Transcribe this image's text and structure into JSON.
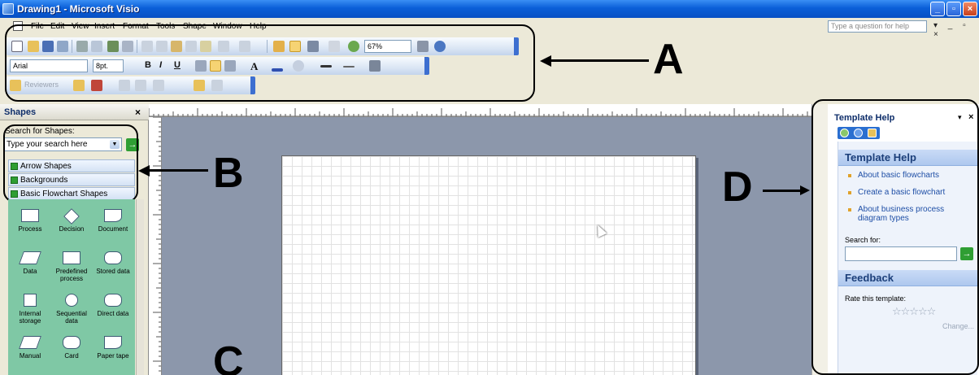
{
  "window": {
    "title": "Drawing1 - Microsoft Visio",
    "min": "_",
    "max": "▫",
    "close": "×"
  },
  "menu": {
    "items": [
      "File",
      "Edit",
      "View",
      "Insert",
      "Format",
      "Tools",
      "Shape",
      "Window",
      "Help"
    ],
    "help_placeholder": "Type a question for help",
    "mdi_controls": "▾ _ ▫ ×"
  },
  "toolbar": {
    "font": "Arial",
    "font_size": "8pt.",
    "zoom": "67%",
    "reviewers_label": "Reviewers"
  },
  "shapes_pane": {
    "title": "Shapes",
    "close": "×",
    "search_label": "Search for Shapes:",
    "search_placeholder": "Type your search here",
    "go": "→",
    "stencils": [
      "Arrow Shapes",
      "Backgrounds",
      "Basic Flowchart Shapes"
    ],
    "masters": [
      "Process",
      "Decision",
      "Document",
      "Data",
      "Predefined process",
      "Stored data",
      "Internal storage",
      "Sequential data",
      "Direct data",
      "Manual",
      "Card",
      "Paper tape"
    ]
  },
  "task_pane": {
    "title": "Template Help",
    "dropdown": "▾",
    "close": "×",
    "section_help": "Template Help",
    "links": [
      "About basic flowcharts",
      "Create a basic flowchart",
      "About business process diagram types"
    ],
    "search_label": "Search for:",
    "go": "→",
    "section_feedback": "Feedback",
    "rate_label": "Rate this template:",
    "stars": "☆☆☆☆☆",
    "change": "Change..."
  },
  "callouts": {
    "a": "A",
    "b": "B",
    "c": "C",
    "d": "D"
  },
  "colors": {
    "titlebar": "#0a5fd8",
    "stencil_bg": "#7fc8a5",
    "canvas_bg": "#8c97ab",
    "task_accent": "#2a6fd0"
  }
}
